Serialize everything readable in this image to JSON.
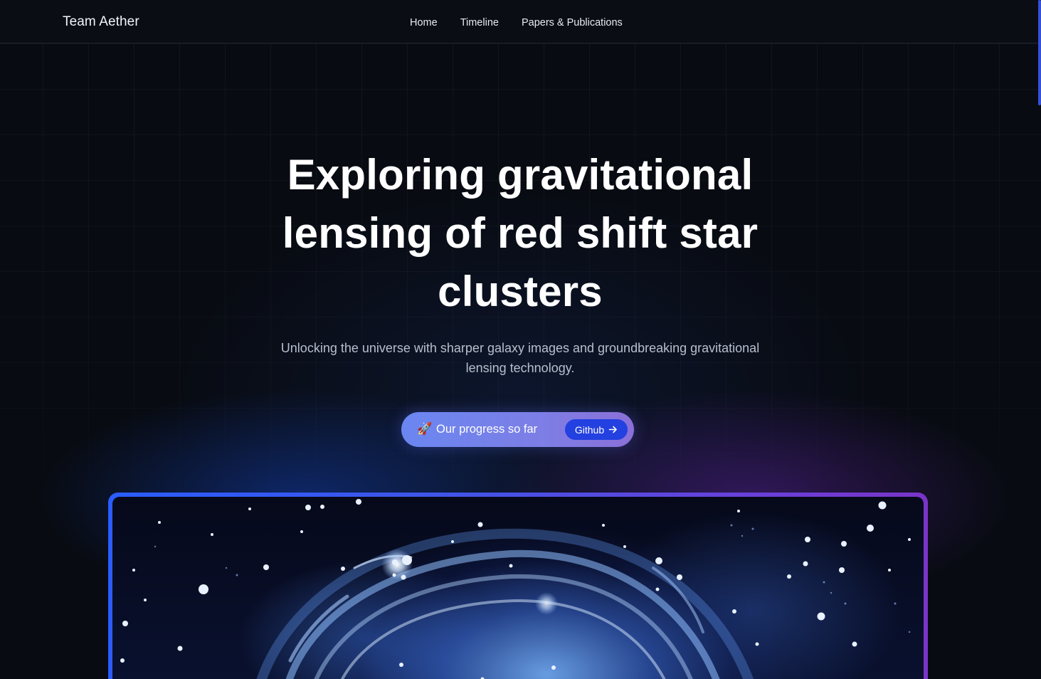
{
  "header": {
    "brand": "Team Aether",
    "nav": [
      {
        "label": "Home"
      },
      {
        "label": "Timeline"
      },
      {
        "label": "Papers & Publications"
      }
    ]
  },
  "hero": {
    "title_lines": [
      "Exploring gravitational",
      "lensing of red shift star",
      "clusters"
    ],
    "subtitle_lines": [
      "Unlocking the universe with sharper galaxy images and groundbreaking gravitational",
      "lensing technology."
    ],
    "cta": {
      "emoji": "🚀",
      "label": "Our progress so far",
      "pill_label": "Github",
      "pill_icon": "arrow-right-icon"
    }
  },
  "showcase": {
    "image_subject": "gravitational lensing galaxy illustration"
  },
  "colors": {
    "background": "#080b12",
    "accent_blue": "#2340e0",
    "accent_purple": "#7a34c8",
    "cta_gradient_start": "#6a86f0",
    "cta_gradient_end": "#8a70d8"
  }
}
